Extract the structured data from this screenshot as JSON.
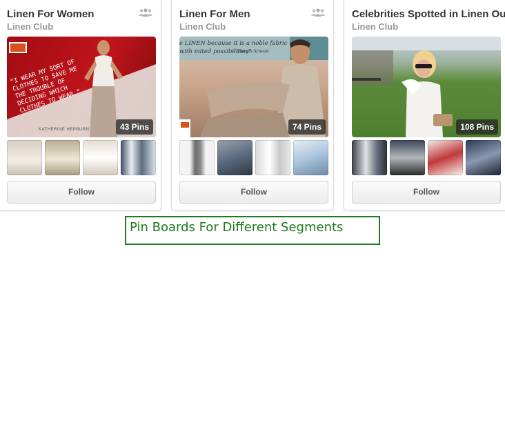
{
  "boards": [
    {
      "title": "Linen For Women",
      "owner": "Linen Club",
      "pins": "43 Pins",
      "follow_label": "Follow",
      "icon": "group-board-icon",
      "cover_quote": "“I WEAR MY SORT OF CLOTHES TO SAVE ME THE TROUBLE OF DECIDING WHICH CLOTHES TO WEAR.”",
      "cover_attribution": "KATHERINE HEPBURN"
    },
    {
      "title": "Linen For Men",
      "owner": "Linen Club",
      "pins": "74 Pins",
      "follow_label": "Follow",
      "icon": "group-board-icon",
      "cover_quote": "e LINEN because it is a noble fabric with mited possibilities”",
      "cover_attribution": "~ Giorgio Armani"
    },
    {
      "title": "Celebrities Spotted in Linen Ou",
      "owner": "Linen Club",
      "pins": "108 Pins",
      "follow_label": "Follow",
      "icon": "group-board-icon"
    }
  ],
  "caption": "Pin Boards For Different Segments",
  "colors": {
    "caption_border": "#1d7a1d",
    "caption_text": "#1a7a1a",
    "title_text": "#333333",
    "owner_text": "#999999"
  }
}
